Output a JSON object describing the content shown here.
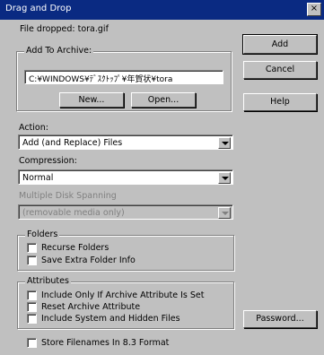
{
  "window": {
    "title": "Drag and Drop",
    "close_glyph": "×"
  },
  "file_dropped": "File dropped: tora.gif",
  "add_to_archive": {
    "legend": "Add To Archive:",
    "path_value": "C:¥WINDOWS¥ﾃﾞｽｸﾄｯﾌﾟ¥年賀状¥tora",
    "new_label": "New...",
    "open_label": "Open..."
  },
  "buttons": {
    "add": "Add",
    "cancel": "Cancel",
    "help": "Help",
    "password": "Password..."
  },
  "action": {
    "label": "Action:",
    "selected": "Add (and Replace) Files"
  },
  "compression": {
    "label": "Compression:",
    "selected": "Normal"
  },
  "spanning": {
    "label": "Multiple Disk Spanning",
    "selected": "(removable media only)"
  },
  "folders": {
    "legend": "Folders",
    "recurse": "Recurse Folders",
    "save_extra": "Save Extra Folder Info"
  },
  "attributes": {
    "legend": "Attributes",
    "only_archive": "Include Only If Archive Attribute Is Set",
    "reset_archive": "Reset Archive Attribute",
    "system_hidden": "Include System and Hidden Files"
  },
  "store_83": "Store Filenames In 8.3 Format"
}
